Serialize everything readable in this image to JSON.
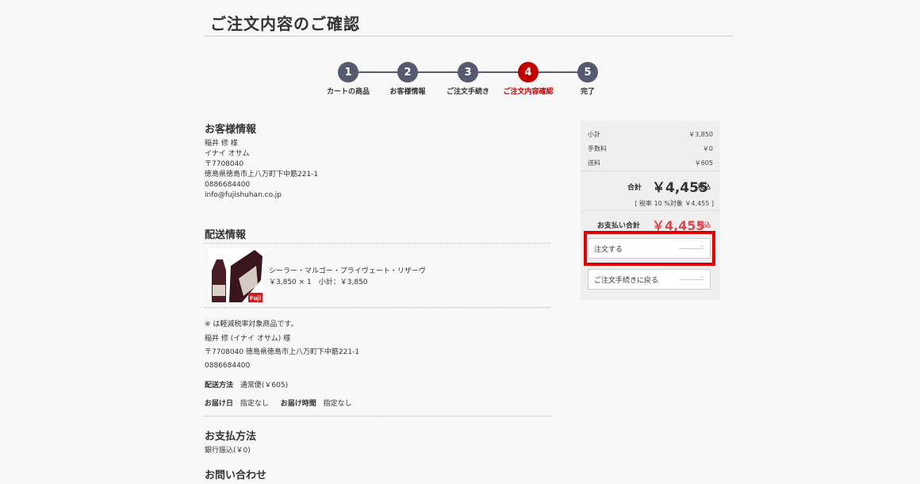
{
  "page": {
    "title": "ご注文内容のご確認"
  },
  "stepper": {
    "steps": [
      {
        "num": "1",
        "label": "カートの商品"
      },
      {
        "num": "2",
        "label": "お客様情報"
      },
      {
        "num": "3",
        "label": "ご注文手続き"
      },
      {
        "num": "4",
        "label": "ご注文内容確認",
        "active": true
      },
      {
        "num": "5",
        "label": "完了"
      }
    ]
  },
  "customer": {
    "heading": "お客様情報",
    "name": "稲井 修 様",
    "kana": "イナイ オサム",
    "postal": "〒7708040",
    "address": "徳島県徳島市上八万町下中筋221-1",
    "phone": "0886684400",
    "email": "info@fujishuhan.co.jp"
  },
  "delivery": {
    "heading": "配送情報",
    "product": {
      "name": "シーラー・マルゴー・プライヴェート・リザーヴ",
      "price_line": "￥3,850 × 1　小計：￥3,850",
      "brand_mark": "Fuji"
    },
    "note": "※ は軽減税率対象商品です。",
    "recipient": "稲井 修 (イナイ オサム) 様",
    "address_line": "〒7708040 徳島県徳島市上八万町下中筋221-1",
    "phone": "0886684400",
    "method_label": "配送方法",
    "method_value": "通常便(￥605)",
    "date_label": "お届け日",
    "date_value": "指定なし",
    "time_label": "お届け時間",
    "time_value": "指定なし"
  },
  "payment": {
    "heading": "お支払方法",
    "value": "銀行振込(￥0)"
  },
  "inquiry": {
    "heading": "お問い合わせ"
  },
  "summary": {
    "subtotal_label": "小計",
    "subtotal_value": "￥3,850",
    "fee_label": "手数料",
    "fee_value": "￥0",
    "shipping_label": "送料",
    "shipping_value": "￥605",
    "total_label": "合計",
    "total_value": "￥4,455",
    "tax_in": "税込",
    "tax_note": "[ 税率 10 %対象 ￥4,455 ]",
    "pay_label": "お支払い合計",
    "pay_value": "￥4,455",
    "pay_tax_in": "税込",
    "order_button": "注文する",
    "back_button": "ご注文手続きに戻る"
  },
  "colors": {
    "accent": "#c00000",
    "step": "#555a6e",
    "pay_total": "#e0474c",
    "highlight": "#e00000"
  }
}
